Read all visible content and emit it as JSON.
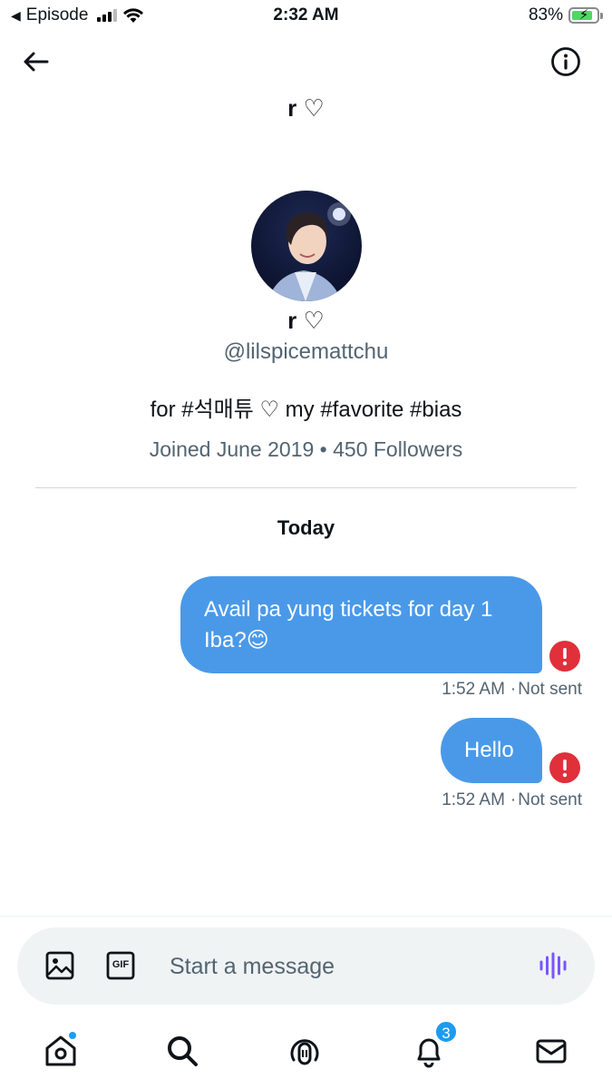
{
  "status_bar": {
    "back_app": "Episode",
    "time": "2:32 AM",
    "battery": "83%",
    "battery_level": 0.83
  },
  "header": {
    "title": "r ♡",
    "back_icon": "arrow-left-icon",
    "info_icon": "info-icon"
  },
  "profile": {
    "name": "r ♡",
    "handle": "@lilspicemattchu",
    "bio": "for #석매튜 ♡ my #favorite #bias",
    "meta": "Joined June 2019 • 450 Followers"
  },
  "conversation": {
    "day_label": "Today",
    "messages": [
      {
        "text": "Avail pa yung tickets for day 1 Iba?😊",
        "time": "1:52 AM",
        "status": "Not sent"
      },
      {
        "text": "Hello",
        "time": "1:52 AM",
        "status": "Not sent"
      }
    ]
  },
  "composer": {
    "placeholder": "Start a message",
    "gif_label": "GIF"
  },
  "bottom_nav": {
    "notifications_badge": "3"
  },
  "colors": {
    "bubble": "#4a99e9",
    "error": "#e0303a",
    "accent": "#1d9bf0",
    "voice": "#7856ff"
  }
}
